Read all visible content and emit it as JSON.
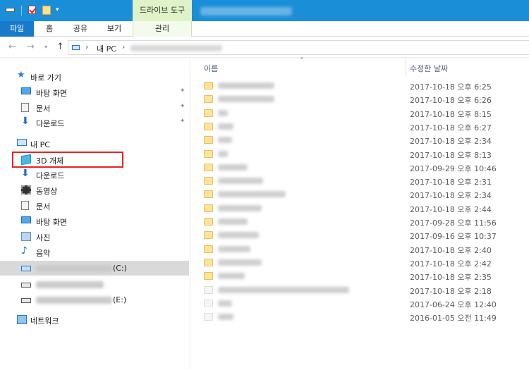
{
  "titlebar": {
    "tool_tab": "드라이브 도구"
  },
  "ribbon": {
    "tabs": [
      "파일",
      "홈",
      "공유",
      "보기",
      "관리"
    ]
  },
  "address": {
    "location": "내 PC"
  },
  "nav": {
    "quick_access": "바로 가기",
    "desktop": "바탕 화면",
    "documents": "문서",
    "downloads": "다운로드",
    "this_pc": "내 PC",
    "objects3d": "3D 개체",
    "downloads2": "다운로드",
    "videos": "동영상",
    "documents2": "문서",
    "desktop2": "바탕 화면",
    "pictures": "사진",
    "music": "음악",
    "drive_c_suffix": "(C:)",
    "drive_e_suffix": "(E:)",
    "network": "네트워크"
  },
  "files": {
    "col_name": "이름",
    "col_date": "수정한 날짜",
    "dates": [
      "2017-10-18 오후 6:25",
      "2017-10-18 오후 6:26",
      "2017-10-18 오후 8:15",
      "2017-10-18 오후 6:27",
      "2017-10-18 오후 2:34",
      "2017-10-18 오후 8:13",
      "2017-09-29 오후 10:46",
      "2017-10-18 오후 2:31",
      "2017-10-18 오후 2:34",
      "2017-10-18 오후 2:44",
      "2017-09-28 오후 11:56",
      "2017-09-16 오후 10:37",
      "2017-10-18 오후 2:40",
      "2017-10-18 오후 2:42",
      "2017-10-18 오후 2:35",
      "2017-10-18 오후 2:18",
      "2017-06-24 오후 12:40",
      "2016-01-05 오전 11:49"
    ]
  }
}
